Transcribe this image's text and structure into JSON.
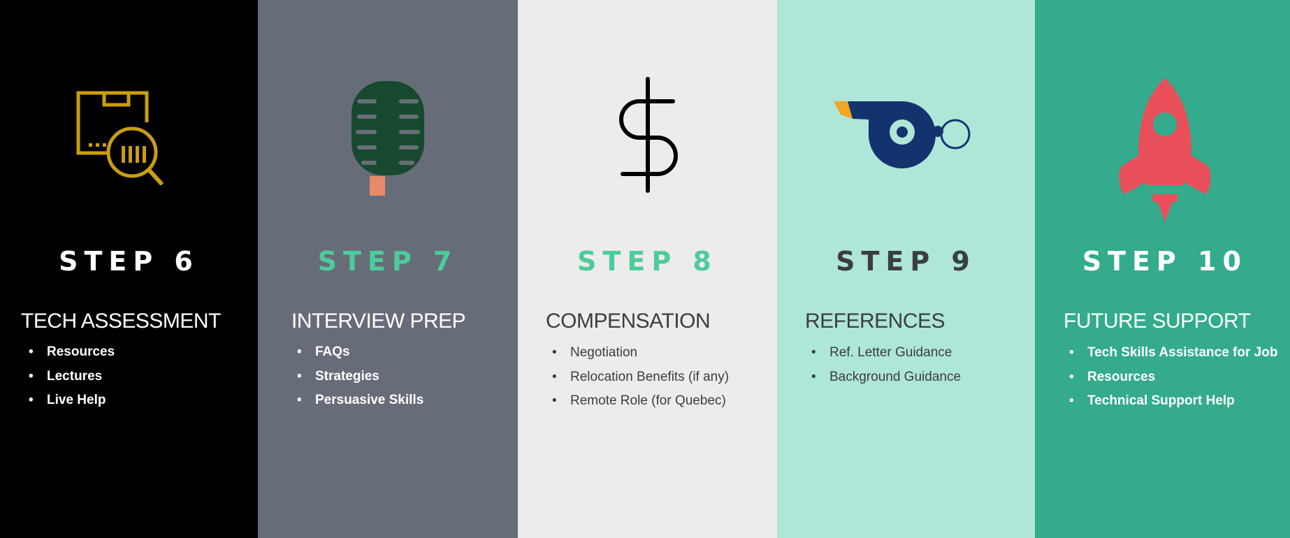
{
  "steps": [
    {
      "step": "STEP 6",
      "heading": "TECH ASSESSMENT",
      "items": [
        "Resources",
        "Lectures",
        "Live Help"
      ],
      "icon": "box-search-icon",
      "colors": {
        "bg": "#000000",
        "step": "#ffffff",
        "text": "#ffffff",
        "icon": "#c99e10"
      }
    },
    {
      "step": "STEP 7",
      "heading": "INTERVIEW PREP",
      "items": [
        "FAQs",
        "Strategies",
        "Persuasive Skills"
      ],
      "icon": "microphone-icon",
      "colors": {
        "bg": "#676d78",
        "step": "#4dcc9a",
        "text": "#ffffff",
        "icon": "#16492e",
        "accent": "#e8896a"
      }
    },
    {
      "step": "STEP 8",
      "heading": "COMPENSATION",
      "items": [
        "Negotiation",
        "Relocation Benefits (if any)",
        "Remote Role (for Quebec)"
      ],
      "icon": "dollar-icon",
      "colors": {
        "bg": "#ececec",
        "step": "#4dcc9a",
        "text": "#3b3d42",
        "icon": "#000000"
      }
    },
    {
      "step": "STEP 9",
      "heading": "REFERENCES",
      "items": [
        "Ref. Letter Guidance",
        "Background Guidance"
      ],
      "icon": "whistle-icon",
      "colors": {
        "bg": "#aee6d8",
        "step": "#3b3d42",
        "text": "#3b3d42",
        "icon": "#13336e",
        "accent": "#f2a51f"
      }
    },
    {
      "step": "STEP 10",
      "heading": "FUTURE SUPPORT",
      "items": [
        "Tech Skills Assistance for Job",
        "Resources",
        "Technical Support Help"
      ],
      "icon": "rocket-icon",
      "colors": {
        "bg": "#33ab8c",
        "step": "#ffffff",
        "text": "#ffffff",
        "icon": "#e94f5a"
      }
    }
  ]
}
